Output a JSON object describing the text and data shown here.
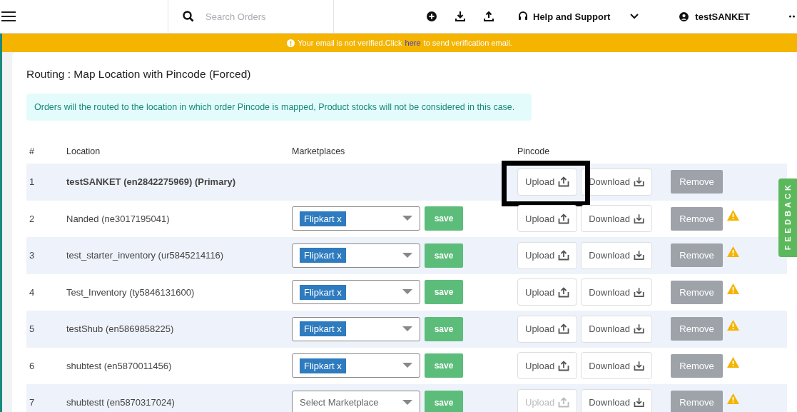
{
  "header": {
    "search": {
      "placeholder": "Search Orders"
    },
    "help": "Help and Support",
    "user": "testSANKET"
  },
  "banner": {
    "before": "Your email is not verified.Click",
    "link": "here",
    "after": "to send verification email."
  },
  "page": {
    "title": "Routing : Map Location with Pincode (Forced)",
    "info": "Orders will the routed to the location in which order Pincode is mapped, Product stocks will not be considered in this case."
  },
  "table": {
    "columns": [
      "#",
      "Location",
      "Marketplaces",
      "Pincode"
    ],
    "rows": [
      {
        "num": "1",
        "location": "testSANKET (en2842275969) (Primary)",
        "primary": true,
        "marketplace": null,
        "save": null,
        "upload": "Upload",
        "upload_disabled": false,
        "upload_highlighted": true,
        "download": "Download",
        "remove": "Remove",
        "warning": false
      },
      {
        "num": "2",
        "location": "Nanded (ne3017195041)",
        "primary": false,
        "marketplace": {
          "kind": "tag",
          "text": "Flipkart x"
        },
        "save": "save",
        "upload": "Upload",
        "upload_disabled": false,
        "upload_highlighted": false,
        "download": "Download",
        "remove": "Remove",
        "warning": true
      },
      {
        "num": "3",
        "location": "test_starter_inventory (ur5845214116)",
        "primary": false,
        "marketplace": {
          "kind": "tag",
          "text": "Flipkart x"
        },
        "save": "save",
        "upload": "Upload",
        "upload_disabled": false,
        "upload_highlighted": false,
        "download": "Download",
        "remove": "Remove",
        "warning": true
      },
      {
        "num": "4",
        "location": "Test_Inventory (ty5846131600)",
        "primary": false,
        "marketplace": {
          "kind": "tag",
          "text": "Flipkart x"
        },
        "save": "save",
        "upload": "Upload",
        "upload_disabled": false,
        "upload_highlighted": false,
        "download": "Download",
        "remove": "Remove",
        "warning": true
      },
      {
        "num": "5",
        "location": "testShub (en5869858225)",
        "primary": false,
        "marketplace": {
          "kind": "tag",
          "text": "Flipkart x"
        },
        "save": "save",
        "upload": "Upload",
        "upload_disabled": false,
        "upload_highlighted": false,
        "download": "Download",
        "remove": "Remove",
        "warning": true
      },
      {
        "num": "6",
        "location": "shubtest (en5870011456)",
        "primary": false,
        "marketplace": {
          "kind": "tag",
          "text": "Flipkart x"
        },
        "save": "save",
        "upload": "Upload",
        "upload_disabled": false,
        "upload_highlighted": false,
        "download": "Download",
        "remove": "Remove",
        "warning": true
      },
      {
        "num": "7",
        "location": "shubtestt (en5870317024)",
        "primary": false,
        "marketplace": {
          "kind": "placeholder",
          "text": "Select Marketplace"
        },
        "save": "save",
        "upload": "Upload",
        "upload_disabled": true,
        "upload_highlighted": false,
        "download": "Download",
        "remove": "Remove",
        "warning": true
      }
    ]
  },
  "feedback": "FEEDBACK"
}
